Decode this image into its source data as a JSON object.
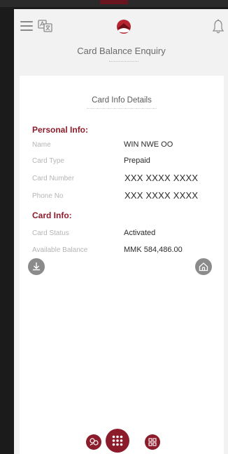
{
  "header": {
    "title": "Card Balance Enquiry"
  },
  "card": {
    "title": "Card Info Details",
    "personal_section": "Personal Info:",
    "card_section": "Card Info:",
    "personal_rows": [
      {
        "label": "Name",
        "value": "WIN NWE OO"
      },
      {
        "label": "Card Type",
        "value": "Prepaid"
      },
      {
        "label": "Card Number",
        "value": "XXX XXXX XXXX"
      },
      {
        "label": "Phone No",
        "value": "XXX XXXX XXXX"
      }
    ],
    "card_rows": [
      {
        "label": "Card Status",
        "value": "Activated"
      },
      {
        "label": "Available Balance",
        "value": "MMK 584,486.00"
      }
    ]
  },
  "colors": {
    "brand": "#8c1c2b",
    "icon_gray": "#8b8b8b",
    "background": "#f2f2f2",
    "card_background": "#ffffff"
  },
  "icons": {
    "menu": "hamburger-icon",
    "translate": "translate-icon",
    "logo": "bank-logo-icon",
    "notifications": "bell-icon",
    "download": "download-icon",
    "home": "home-icon",
    "nav_left": "people-icon",
    "nav_center": "keypad-icon",
    "nav_right": "qr-scan-icon"
  }
}
